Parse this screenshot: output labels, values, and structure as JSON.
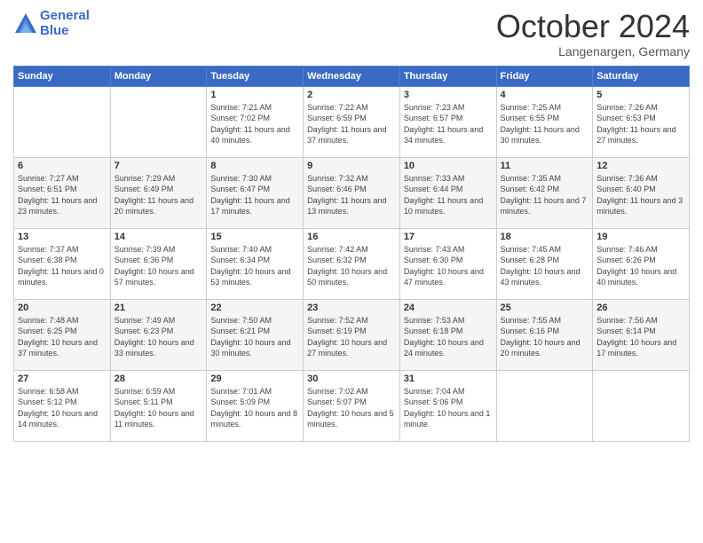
{
  "header": {
    "logo_line1": "General",
    "logo_line2": "Blue",
    "month_title": "October 2024",
    "location": "Langenargen, Germany"
  },
  "days_of_week": [
    "Sunday",
    "Monday",
    "Tuesday",
    "Wednesday",
    "Thursday",
    "Friday",
    "Saturday"
  ],
  "weeks": [
    [
      {
        "day": "",
        "info": ""
      },
      {
        "day": "",
        "info": ""
      },
      {
        "day": "1",
        "info": "Sunrise: 7:21 AM\nSunset: 7:02 PM\nDaylight: 11 hours and 40 minutes."
      },
      {
        "day": "2",
        "info": "Sunrise: 7:22 AM\nSunset: 6:59 PM\nDaylight: 11 hours and 37 minutes."
      },
      {
        "day": "3",
        "info": "Sunrise: 7:23 AM\nSunset: 6:57 PM\nDaylight: 11 hours and 34 minutes."
      },
      {
        "day": "4",
        "info": "Sunrise: 7:25 AM\nSunset: 6:55 PM\nDaylight: 11 hours and 30 minutes."
      },
      {
        "day": "5",
        "info": "Sunrise: 7:26 AM\nSunset: 6:53 PM\nDaylight: 11 hours and 27 minutes."
      }
    ],
    [
      {
        "day": "6",
        "info": "Sunrise: 7:27 AM\nSunset: 6:51 PM\nDaylight: 11 hours and 23 minutes."
      },
      {
        "day": "7",
        "info": "Sunrise: 7:29 AM\nSunset: 6:49 PM\nDaylight: 11 hours and 20 minutes."
      },
      {
        "day": "8",
        "info": "Sunrise: 7:30 AM\nSunset: 6:47 PM\nDaylight: 11 hours and 17 minutes."
      },
      {
        "day": "9",
        "info": "Sunrise: 7:32 AM\nSunset: 6:46 PM\nDaylight: 11 hours and 13 minutes."
      },
      {
        "day": "10",
        "info": "Sunrise: 7:33 AM\nSunset: 6:44 PM\nDaylight: 11 hours and 10 minutes."
      },
      {
        "day": "11",
        "info": "Sunrise: 7:35 AM\nSunset: 6:42 PM\nDaylight: 11 hours and 7 minutes."
      },
      {
        "day": "12",
        "info": "Sunrise: 7:36 AM\nSunset: 6:40 PM\nDaylight: 11 hours and 3 minutes."
      }
    ],
    [
      {
        "day": "13",
        "info": "Sunrise: 7:37 AM\nSunset: 6:38 PM\nDaylight: 11 hours and 0 minutes."
      },
      {
        "day": "14",
        "info": "Sunrise: 7:39 AM\nSunset: 6:36 PM\nDaylight: 10 hours and 57 minutes."
      },
      {
        "day": "15",
        "info": "Sunrise: 7:40 AM\nSunset: 6:34 PM\nDaylight: 10 hours and 53 minutes."
      },
      {
        "day": "16",
        "info": "Sunrise: 7:42 AM\nSunset: 6:32 PM\nDaylight: 10 hours and 50 minutes."
      },
      {
        "day": "17",
        "info": "Sunrise: 7:43 AM\nSunset: 6:30 PM\nDaylight: 10 hours and 47 minutes."
      },
      {
        "day": "18",
        "info": "Sunrise: 7:45 AM\nSunset: 6:28 PM\nDaylight: 10 hours and 43 minutes."
      },
      {
        "day": "19",
        "info": "Sunrise: 7:46 AM\nSunset: 6:26 PM\nDaylight: 10 hours and 40 minutes."
      }
    ],
    [
      {
        "day": "20",
        "info": "Sunrise: 7:48 AM\nSunset: 6:25 PM\nDaylight: 10 hours and 37 minutes."
      },
      {
        "day": "21",
        "info": "Sunrise: 7:49 AM\nSunset: 6:23 PM\nDaylight: 10 hours and 33 minutes."
      },
      {
        "day": "22",
        "info": "Sunrise: 7:50 AM\nSunset: 6:21 PM\nDaylight: 10 hours and 30 minutes."
      },
      {
        "day": "23",
        "info": "Sunrise: 7:52 AM\nSunset: 6:19 PM\nDaylight: 10 hours and 27 minutes."
      },
      {
        "day": "24",
        "info": "Sunrise: 7:53 AM\nSunset: 6:18 PM\nDaylight: 10 hours and 24 minutes."
      },
      {
        "day": "25",
        "info": "Sunrise: 7:55 AM\nSunset: 6:16 PM\nDaylight: 10 hours and 20 minutes."
      },
      {
        "day": "26",
        "info": "Sunrise: 7:56 AM\nSunset: 6:14 PM\nDaylight: 10 hours and 17 minutes."
      }
    ],
    [
      {
        "day": "27",
        "info": "Sunrise: 6:58 AM\nSunset: 5:12 PM\nDaylight: 10 hours and 14 minutes."
      },
      {
        "day": "28",
        "info": "Sunrise: 6:59 AM\nSunset: 5:11 PM\nDaylight: 10 hours and 11 minutes."
      },
      {
        "day": "29",
        "info": "Sunrise: 7:01 AM\nSunset: 5:09 PM\nDaylight: 10 hours and 8 minutes."
      },
      {
        "day": "30",
        "info": "Sunrise: 7:02 AM\nSunset: 5:07 PM\nDaylight: 10 hours and 5 minutes."
      },
      {
        "day": "31",
        "info": "Sunrise: 7:04 AM\nSunset: 5:06 PM\nDaylight: 10 hours and 1 minute."
      },
      {
        "day": "",
        "info": ""
      },
      {
        "day": "",
        "info": ""
      }
    ]
  ]
}
